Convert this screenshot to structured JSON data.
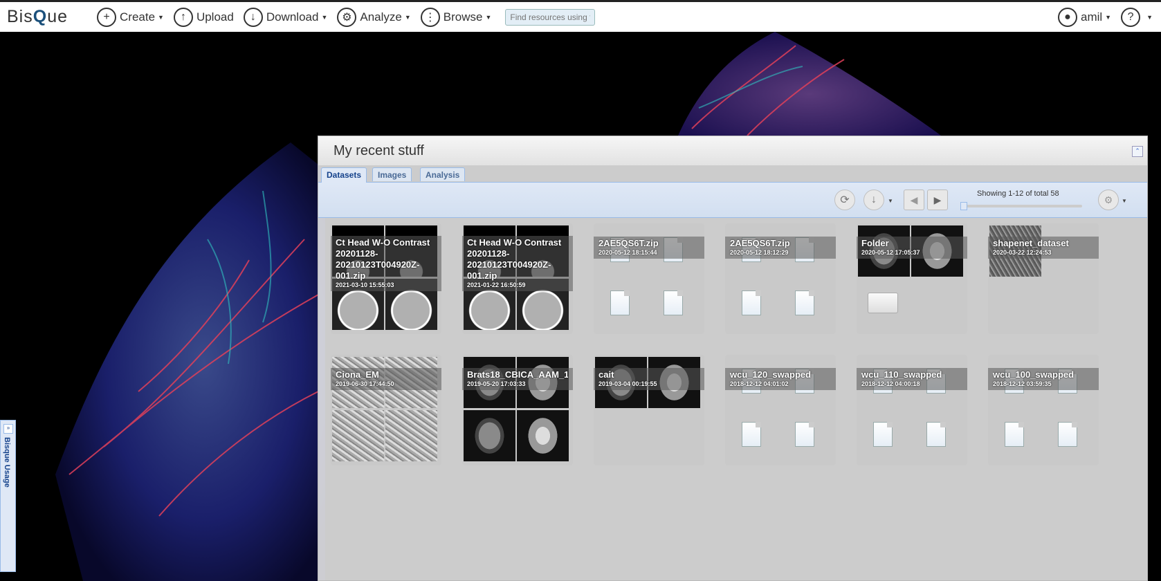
{
  "navbar": {
    "logo": {
      "part1": "Bis",
      "part2": "Q",
      "part3": "ue"
    },
    "items": [
      {
        "label": "Create",
        "icon": "plus-icon"
      },
      {
        "label": "Upload",
        "icon": "upload-icon"
      },
      {
        "label": "Download",
        "icon": "download-icon"
      },
      {
        "label": "Analyze",
        "icon": "analyze-icon"
      },
      {
        "label": "Browse",
        "icon": "grid-icon"
      }
    ],
    "search_placeholder": "Find resources using tags",
    "user": "amil",
    "help": "?"
  },
  "panel": {
    "title": "My recent stuff",
    "tabs": [
      "Datasets",
      "Images",
      "Analysis"
    ],
    "active_tab": "Datasets",
    "paging": "Showing 1-12 of total 58"
  },
  "cards": [
    {
      "title": "Ct Head W-O Contrast\n20201128-\n20210123T004920Z-\n001.zip",
      "date": "2021-03-10 15:55:03"
    },
    {
      "title": "Ct Head W-O Contrast\n20201128-\n20210123T004920Z-\n001.zip",
      "date": "2021-01-22 16:50:59"
    },
    {
      "title": "2AE5QS6T.zip",
      "date": "2020-05-12 18:15:44"
    },
    {
      "title": "2AE5QS6T.zip",
      "date": "2020-05-12 18:12:29"
    },
    {
      "title": "Folder",
      "date": "2020-05-12 17:05:37"
    },
    {
      "title": "shapenet_dataset",
      "date": "2020-03-22 12:24:53"
    },
    {
      "title": "Ciona_EM",
      "date": "2019-06-30 17:44:50"
    },
    {
      "title": "Brats18_CBICA_AAM_1",
      "date": "2019-05-20 17:03:33"
    },
    {
      "title": "cait",
      "date": "2019-03-04 00:19:55"
    },
    {
      "title": "wcu_120_swapped",
      "date": "2018-12-12 04:01:02"
    },
    {
      "title": "wcu_110_swapped",
      "date": "2018-12-12 04:00:18"
    },
    {
      "title": "wcu_100_swapped",
      "date": "2018-12-12 03:59:35"
    }
  ],
  "side_tab": {
    "label": "Bisque Usage"
  },
  "colors": {
    "panel_border": "#99bbe8",
    "tab_text": "#15428b",
    "navbar_bg": "#ffffff"
  }
}
